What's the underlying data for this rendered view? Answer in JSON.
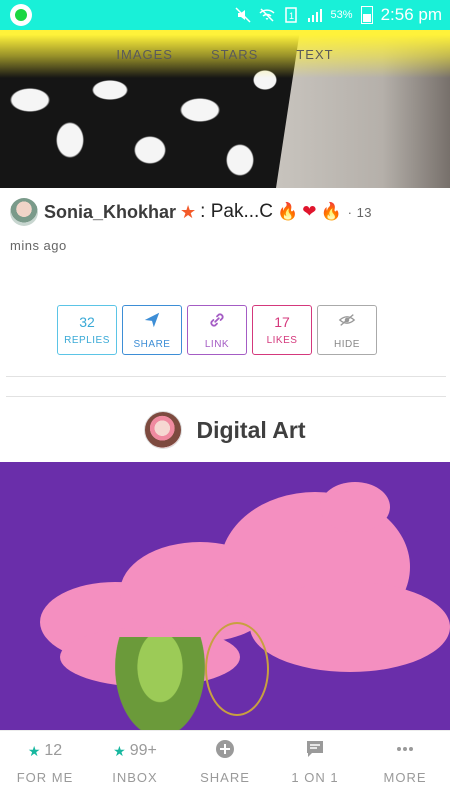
{
  "status_bar": {
    "battery": "53%",
    "time": "2:56 pm",
    "app_icon": "whatsapp-icon"
  },
  "top_tabs": [
    "IMAGES",
    "STARS",
    "TEXT"
  ],
  "post": {
    "username": "Sonia_Khokhar",
    "text": ": Pak...C",
    "time_prefix": "· 13",
    "time_suffix": "mins ago",
    "emojis": [
      "fire",
      "heart",
      "fire"
    ]
  },
  "actions": {
    "replies": {
      "count": "32",
      "label": "REPLIES"
    },
    "share": {
      "label": "SHARE"
    },
    "link": {
      "label": "LINK"
    },
    "likes": {
      "count": "17",
      "label": "LIKES"
    },
    "hide": {
      "label": "HIDE"
    }
  },
  "section": {
    "title": "Digital Art"
  },
  "bottom_nav": {
    "for_me": {
      "count": "12",
      "label": "FOR ME"
    },
    "inbox": {
      "count": "99+",
      "label": "INBOX"
    },
    "share": {
      "label": "SHARE"
    },
    "one_on_one": {
      "label": "1 ON 1"
    },
    "more": {
      "label": "MORE"
    }
  },
  "colors": {
    "status_bar": "#19f0d8",
    "accent_teal": "#17b79f",
    "replies": "#39a9d6",
    "share": "#3d8ed6",
    "link": "#a45cc4",
    "likes": "#d4387c",
    "hide": "#888888"
  }
}
